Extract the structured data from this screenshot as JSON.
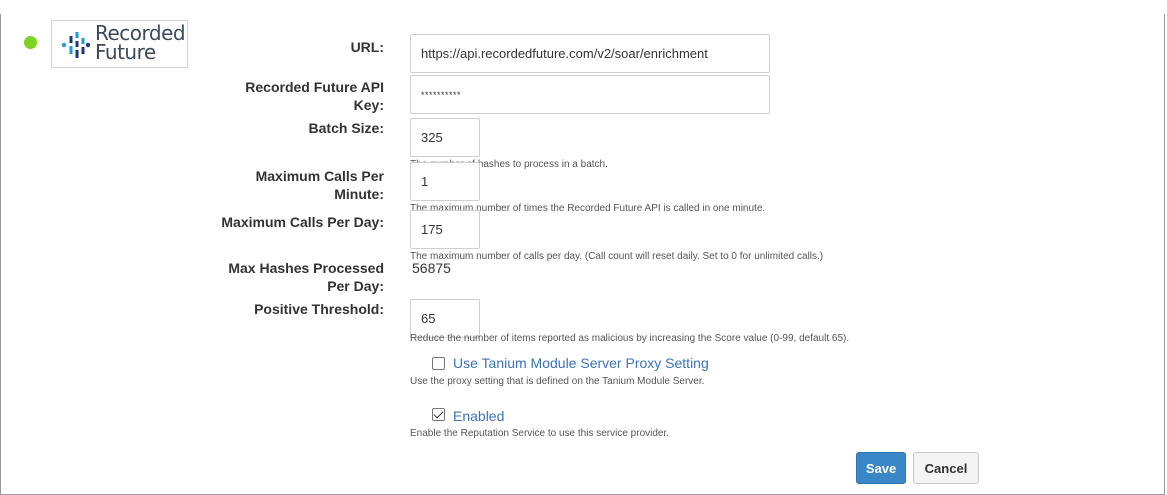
{
  "caption": "                                                          ",
  "provider": {
    "logo": {
      "line1": "Recorded",
      "line2": "Future",
      "brand_color": "#3a7bd5"
    },
    "status_color": "#7ed321"
  },
  "fields": {
    "url": {
      "label": "URL:",
      "value": "https://api.recordedfuture.com/v2/soar/enrichment"
    },
    "api_key": {
      "label_line1": "Recorded Future API",
      "label_line2": "Key:",
      "value": "**********"
    },
    "batch_size": {
      "label": "Batch Size:",
      "value": "325",
      "help": "The number of hashes to process in a batch."
    },
    "max_calls_per_minute": {
      "label_line1": "Maximum Calls Per",
      "label_line2": "Minute:",
      "value": "1",
      "help": "The maximum number of times the Recorded Future API is called in one minute."
    },
    "max_calls_per_day": {
      "label": "Maximum Calls Per Day:",
      "value": "175",
      "help": "The maximum number of calls per day. (Call count will reset daily. Set to 0 for unlimited calls.)"
    },
    "max_hashes_per_day": {
      "label_line1": "Max Hashes Processed",
      "label_line2": "Per Day:",
      "value": "56875"
    },
    "positive_threshold": {
      "label": "Positive Threshold:",
      "value": "65",
      "help": "Reduce the number of items reported as malicious by increasing the Score value (0-99, default 65)."
    }
  },
  "options": {
    "proxy": {
      "label": "Use Tanium Module Server Proxy Setting",
      "checked": false,
      "help": "Use the proxy setting that is defined on the Tanium Module Server."
    },
    "enabled": {
      "label": "Enabled",
      "checked": true,
      "help": "Enable the Reputation Service to use this service provider."
    }
  },
  "buttons": {
    "save": "Save",
    "cancel": "Cancel"
  }
}
